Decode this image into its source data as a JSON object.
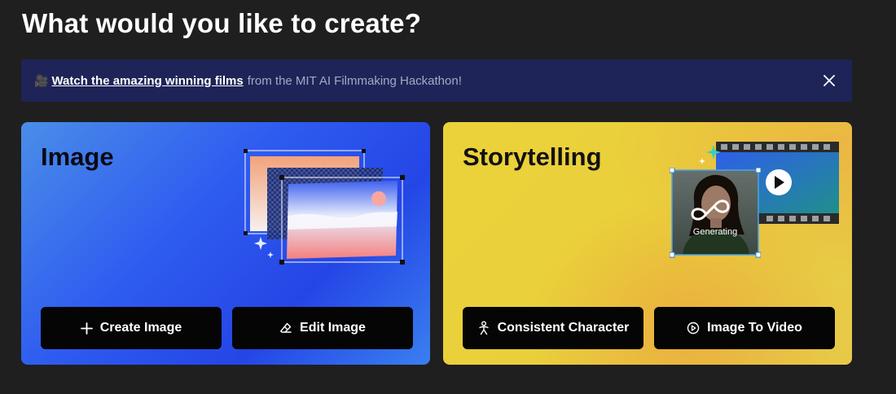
{
  "page": {
    "title": "What would you like to create?"
  },
  "banner": {
    "emoji": "🎥",
    "link_text": "Watch the amazing winning films",
    "rest_text": "from the MIT AI Filmmaking Hackathon!"
  },
  "cards": {
    "image": {
      "title": "Image",
      "buttons": [
        {
          "label": "Create Image",
          "icon": "plus-icon"
        },
        {
          "label": "Edit Image",
          "icon": "eraser-icon"
        }
      ]
    },
    "story": {
      "title": "Storytelling",
      "generating_label": "Generating",
      "buttons": [
        {
          "label": "Consistent Character",
          "icon": "person-icon"
        },
        {
          "label": "Image To Video",
          "icon": "play-circle-icon"
        }
      ]
    }
  },
  "colors": {
    "background": "#1f1f1f",
    "banner": "#1f2458",
    "image_card": "#2f5cf0",
    "story_card": "#e9cf3b",
    "button": "#050505"
  }
}
